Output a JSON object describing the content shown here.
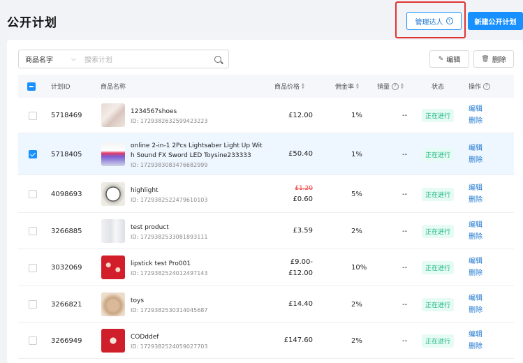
{
  "page": {
    "title": "公开计划"
  },
  "header": {
    "manage_label": "管理达人",
    "new_label": "新建公开计划"
  },
  "filter": {
    "select_value": "商品名字",
    "search_placeholder": "搜索计划"
  },
  "toolbar": {
    "edit_label": "编辑",
    "delete_label": "删除"
  },
  "columns": {
    "plan_id": "计划ID",
    "product_name": "商品名称",
    "price": "商品价格",
    "commission": "佣金率",
    "sales": "销量",
    "status": "状态",
    "actions": "操作"
  },
  "rows": [
    {
      "id": "5718469",
      "name": "1234567shoes",
      "product_id": "ID: 1729382632599423223",
      "price": "£12.00",
      "commission": "1%",
      "sales": "--",
      "status": "正在进行",
      "edit": "编辑",
      "delete": "删除"
    },
    {
      "id": "5718405",
      "name": "online 2-in-1 2Pcs Lightsaber Light Up Wit",
      "name2": "h Sound FX Sword LED Toysine233333",
      "product_id": "ID: 1729383083476682999",
      "price": "£50.40",
      "commission": "1%",
      "sales": "--",
      "status": "正在进行",
      "edit": "编辑",
      "delete": "删除",
      "checked": true
    },
    {
      "id": "4098693",
      "name": "highlight",
      "product_id": "ID: 1729382522479610103",
      "price_old": "£1.20",
      "price": "£0.60",
      "commission": "5%",
      "sales": "--",
      "status": "正在进行",
      "edit": "编辑",
      "delete": "删除"
    },
    {
      "id": "3266885",
      "name": "test product",
      "product_id": "ID: 1729382533081893111",
      "price": "£3.59",
      "commission": "2%",
      "sales": "--",
      "status": "正在进行",
      "edit": "编辑",
      "delete": "删除"
    },
    {
      "id": "3032069",
      "name": "lipstick test Pro001",
      "product_id": "ID: 1729382524012497143",
      "price": "£9.00-",
      "price2": "£12.00",
      "commission": "10%",
      "sales": "--",
      "status": "正在进行",
      "edit": "编辑",
      "delete": "删除"
    },
    {
      "id": "3266821",
      "name": "toys",
      "product_id": "ID: 1729382530314045687",
      "price": "£14.40",
      "commission": "2%",
      "sales": "--",
      "status": "正在进行",
      "edit": "编辑",
      "delete": "删除"
    },
    {
      "id": "3266949",
      "name": "CODddef",
      "product_id": "ID: 1729382524059027703",
      "price": "£147.60",
      "commission": "2%",
      "sales": "--",
      "status": "正在进行",
      "edit": "编辑",
      "delete": "删除"
    }
  ],
  "colors": {
    "primary": "#1890ff",
    "status_green": "#16b47c",
    "highlight_red": "#e03333"
  }
}
